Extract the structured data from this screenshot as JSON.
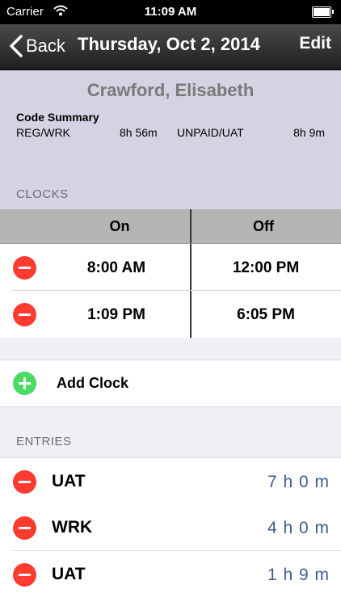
{
  "status": {
    "carrier": "Carrier",
    "time": "11:09 AM"
  },
  "nav": {
    "back_label": "Back",
    "title": "Thursday, Oct 2, 2014",
    "edit_label": "Edit"
  },
  "summary": {
    "name": "Crawford, Elisabeth",
    "code_summary_label": "Code Summary",
    "codes": [
      {
        "code": "REG/WRK",
        "value": "8h 56m"
      },
      {
        "code": "UNPAID/UAT",
        "value": "8h 9m"
      }
    ]
  },
  "clocks": {
    "header": "CLOCKS",
    "col_on": "On",
    "col_off": "Off",
    "rows": [
      {
        "on": "8:00 AM",
        "off": "12:00 PM"
      },
      {
        "on": "1:09 PM",
        "off": "6:05 PM"
      }
    ],
    "add_label": "Add Clock"
  },
  "entries": {
    "header": "ENTRIES",
    "rows": [
      {
        "code": "UAT",
        "duration": "7 h 0 m"
      },
      {
        "code": "WRK",
        "duration": "4 h 0 m"
      },
      {
        "code": "UAT",
        "duration": "1 h 9 m"
      }
    ]
  },
  "colors": {
    "delete": "#ff3b30",
    "add": "#4cd964",
    "duration": "#3b5d8f",
    "summary_bg": "#d3d3e3"
  }
}
